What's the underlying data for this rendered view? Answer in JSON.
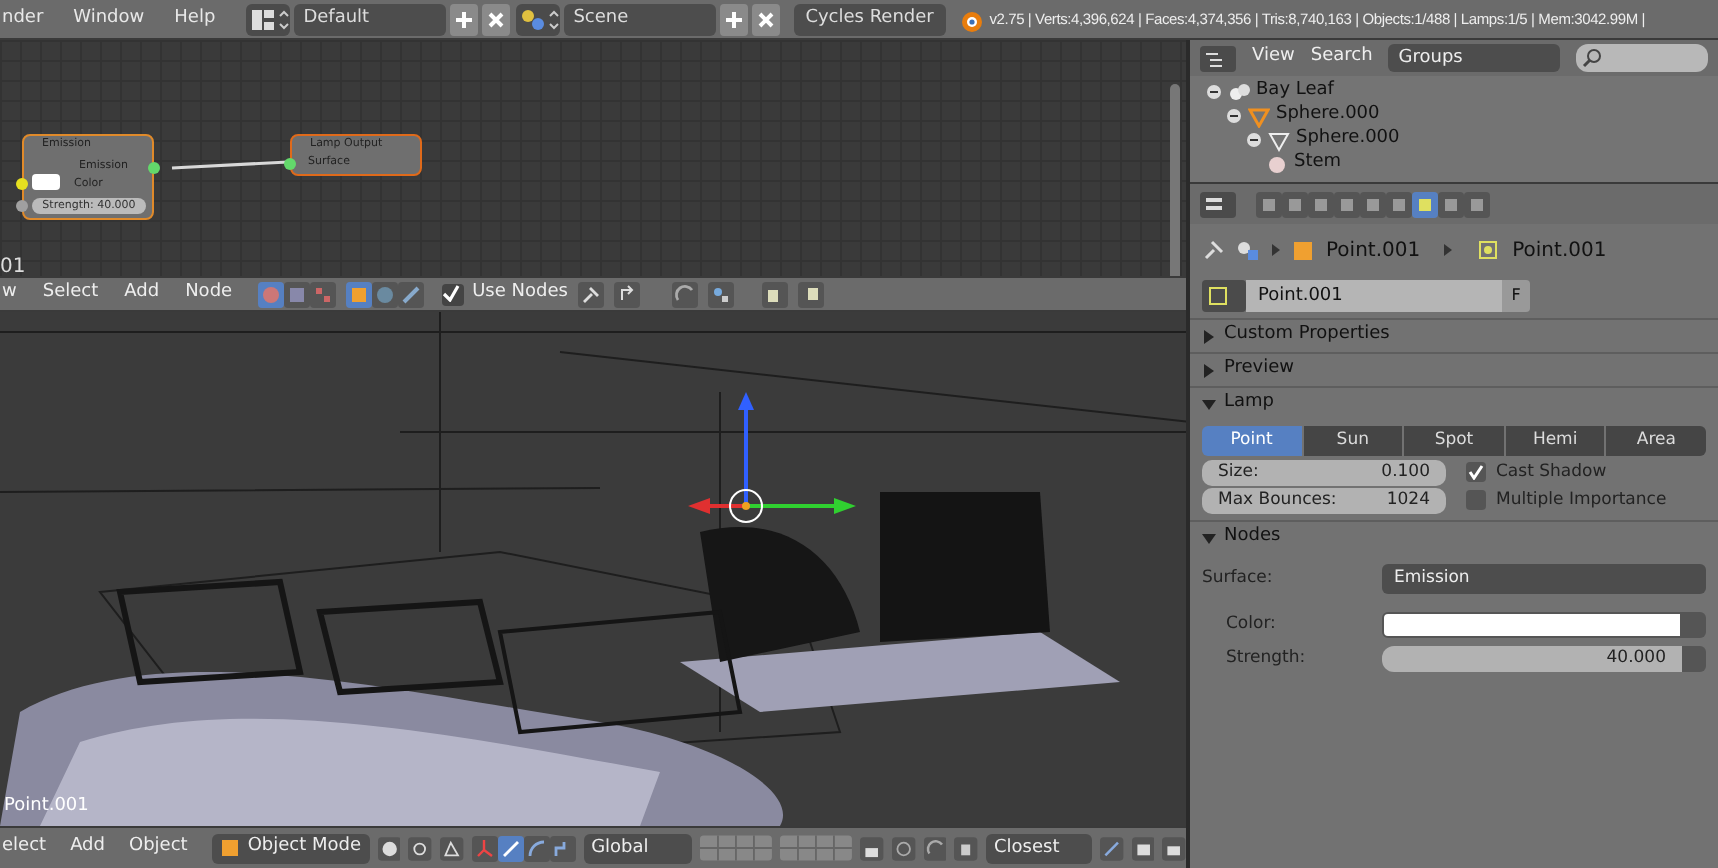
{
  "top_bar": {
    "menus": [
      "nder",
      "Window",
      "Help"
    ],
    "screen_layout": "Default",
    "scene": "Scene",
    "render_engine": "Cycles Render",
    "stats": "v2.75 | Verts:4,396,624 | Faces:4,374,356 | Tris:8,740,163 | Objects:1/488 | Lamps:1/5 | Mem:3042.99M |"
  },
  "node_editor": {
    "view_label": "01",
    "nodes": [
      {
        "kind": "emission",
        "title": "Emission",
        "output": "Emission",
        "color_label": "Color",
        "strength": "Strength: 40.000"
      },
      {
        "kind": "output",
        "title": "Lamp Output",
        "input": "Surface"
      }
    ]
  },
  "node_header": {
    "menus": [
      "w",
      "Select",
      "Add",
      "Node"
    ],
    "use_nodes": {
      "label": "Use Nodes",
      "checked": true
    }
  },
  "viewport": {
    "object_label": "Point.001"
  },
  "viewport_header": {
    "menus": [
      "elect",
      "Add",
      "Object"
    ],
    "mode": "Object Mode",
    "orientation": "Global",
    "snap": "Closest"
  },
  "outliner": {
    "menus": [
      "View",
      "Search"
    ],
    "display": "Groups",
    "items": [
      {
        "label": "Bay Leaf",
        "kind": "empty",
        "children": [
          {
            "label": "Sphere.000",
            "kind": "object",
            "children": [
              {
                "label": "Sphere.000",
                "kind": "mesh",
                "children": [
                  {
                    "label": "Stem",
                    "kind": "material"
                  }
                ]
              }
            ]
          }
        ]
      }
    ]
  },
  "properties": {
    "breadcrumb": [
      "Point.001",
      "Point.001"
    ],
    "datablock": "Point.001",
    "fake_user": "F",
    "panels": [
      {
        "title": "Custom Properties",
        "expanded": false
      },
      {
        "title": "Preview",
        "expanded": false
      },
      {
        "kind": "lamp",
        "title": "Lamp",
        "expanded": true,
        "lamp_types": [
          {
            "label": "Point",
            "selected": true
          },
          {
            "label": "Sun",
            "selected": false
          },
          {
            "label": "Spot",
            "selected": false
          },
          {
            "label": "Hemi",
            "selected": false
          },
          {
            "label": "Area",
            "selected": false
          }
        ],
        "fields": [
          {
            "label": "Size:",
            "value": "0.100"
          },
          {
            "label": "Max Bounces:",
            "value": "1024"
          }
        ],
        "options": [
          {
            "label": "Cast Shadow",
            "checked": true
          },
          {
            "label": "Multiple Importance",
            "checked": false
          }
        ]
      },
      {
        "kind": "nodes",
        "title": "Nodes",
        "expanded": true,
        "surface": {
          "label": "Surface:",
          "value": "Emission"
        },
        "color": {
          "label": "Color:"
        },
        "strength": {
          "label": "Strength:",
          "value": "40.000"
        }
      }
    ]
  }
}
